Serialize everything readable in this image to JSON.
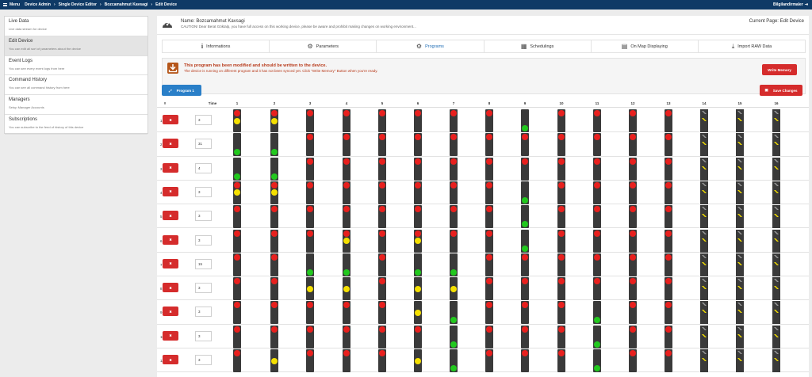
{
  "topbar": {
    "menu_label": "Menu",
    "breadcrumbs": [
      "Device Admin",
      "Single Device Editor",
      "Bozcamahmut Kavsagi",
      "Edit Device"
    ],
    "user": "Bilgilandirmaler"
  },
  "sidebar": {
    "items": [
      {
        "title": "Live Data",
        "desc": "Live data stream for device",
        "active": false
      },
      {
        "title": "Edit Device",
        "desc": "You can edit all sort of parameters about the device",
        "active": true
      },
      {
        "title": "Event Logs",
        "desc": "You can see every event logs from here",
        "active": false
      },
      {
        "title": "Command History",
        "desc": "You can see all command history from here",
        "active": false
      },
      {
        "title": "Managers",
        "desc": "Setup Manager Accounts",
        "active": false
      },
      {
        "title": "Subscriptions",
        "desc": "You can subscribe to the feed of history of this device",
        "active": false
      }
    ]
  },
  "header": {
    "name": "Name: Bozcamahmut Kavsagi",
    "caution": "CAUTION! Dear Berat Göktalp, you have full access on this working device, please be aware and prohibit making changes on working environment...",
    "current_page": "Current Page: Edit Device"
  },
  "tabs": [
    {
      "label": "Informations",
      "icon": "info-icon"
    },
    {
      "label": "Parameters",
      "icon": "gears-icon"
    },
    {
      "label": "Programs",
      "icon": "gears-icon",
      "active": true
    },
    {
      "label": "Schedulings",
      "icon": "calendar-icon"
    },
    {
      "label": "On Map Displaying",
      "icon": "map-icon"
    },
    {
      "label": "Import RAW Data",
      "icon": "download-icon"
    }
  ],
  "alert": {
    "title": "This program has been modified and should be written to the device.",
    "desc": "The device is running on different program and it has not been synced yet. Click \"Write Memory\" Button when you're ready.",
    "button": "Write Memory"
  },
  "program_button": "Program 1",
  "save_button": "Save Changes",
  "grid": {
    "headers": {
      "index": "#",
      "time": "Time",
      "columns": [
        "1",
        "2",
        "3",
        "4",
        "5",
        "6",
        "7",
        "8",
        "9",
        "10",
        "11",
        "12",
        "13",
        "14",
        "15",
        "16"
      ]
    },
    "colors": {
      "red": "#e8201e",
      "yellow": "#f5e000",
      "green": "#22c81e",
      "off": "#3a3a3a"
    },
    "rows": [
      {
        "num": "1",
        "time": "3",
        "states": [
          "RY",
          "RY",
          "R",
          "R",
          "R",
          "R",
          "R",
          "R",
          "G",
          "R",
          "R",
          "R",
          "R",
          "T",
          "T",
          "T"
        ]
      },
      {
        "num": "2",
        "time": "31",
        "states": [
          "G",
          "G",
          "R",
          "R",
          "R",
          "R",
          "R",
          "R",
          "R",
          "R",
          "R",
          "R",
          "R",
          "T",
          "T",
          "T"
        ]
      },
      {
        "num": "3",
        "time": "4",
        "states": [
          "G",
          "G",
          "R",
          "R",
          "R",
          "R",
          "R",
          "R",
          "R",
          "R",
          "R",
          "R",
          "R",
          "T",
          "T",
          "T"
        ]
      },
      {
        "num": "4",
        "time": "3",
        "states": [
          "RY",
          "RY",
          "R",
          "R",
          "R",
          "R",
          "R",
          "R",
          "G",
          "R",
          "R",
          "R",
          "R",
          "T",
          "T",
          "T"
        ]
      },
      {
        "num": "5",
        "time": "3",
        "states": [
          "R",
          "R",
          "R",
          "R",
          "R",
          "R",
          "R",
          "R",
          "G",
          "R",
          "R",
          "R",
          "R",
          "T",
          "T",
          "T"
        ]
      },
      {
        "num": "6",
        "time": "3",
        "states": [
          "R",
          "R",
          "R",
          "RY",
          "R",
          "RY",
          "R",
          "R",
          "G",
          "R",
          "R",
          "R",
          "R",
          "T",
          "T",
          "T"
        ]
      },
      {
        "num": "7",
        "time": "15",
        "states": [
          "R",
          "R",
          "G",
          "G",
          "R",
          "G",
          "G",
          "R",
          "R",
          "R",
          "R",
          "R",
          "R",
          "T",
          "T",
          "T"
        ]
      },
      {
        "num": "8",
        "time": "3",
        "states": [
          "R",
          "R",
          "Y",
          "Y",
          "R",
          "Y",
          "Y",
          "R",
          "R",
          "R",
          "R",
          "R",
          "R",
          "T",
          "T",
          "T"
        ]
      },
      {
        "num": "9",
        "time": "3",
        "states": [
          "R",
          "R",
          "R",
          "R",
          "R",
          "Y",
          "G",
          "R",
          "R",
          "R",
          "G",
          "R",
          "R",
          "T",
          "T",
          "T"
        ]
      },
      {
        "num": "10",
        "time": "3",
        "states": [
          "R",
          "R",
          "R",
          "R",
          "R",
          "R",
          "G",
          "R",
          "R",
          "R",
          "G",
          "R",
          "R",
          "T",
          "T",
          "T"
        ]
      },
      {
        "num": "11",
        "time": "3",
        "states": [
          "R",
          "Y",
          "R",
          "R",
          "R",
          "Y",
          "G",
          "R",
          "R",
          "R",
          "G",
          "R",
          "R",
          "T",
          "T",
          "T"
        ]
      }
    ]
  }
}
